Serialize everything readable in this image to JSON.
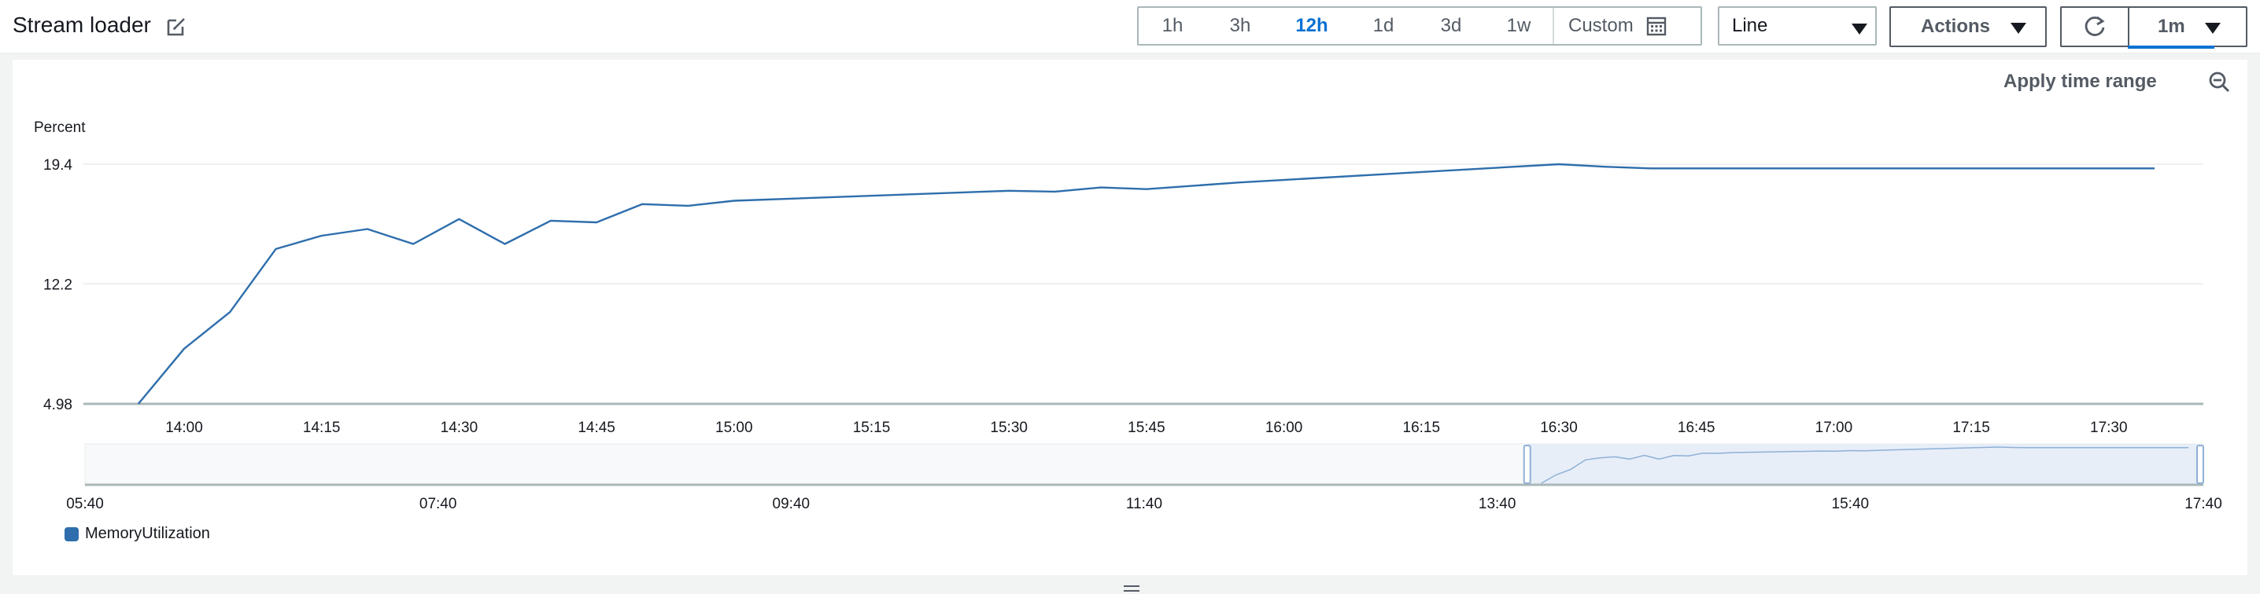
{
  "header": {
    "title": "Stream loader",
    "ranges": [
      "1h",
      "3h",
      "12h",
      "1d",
      "3d",
      "1w"
    ],
    "active_range": "12h",
    "custom_label": "Custom",
    "chart_type": "Line",
    "actions_label": "Actions",
    "interval": "1m"
  },
  "panel": {
    "apply_label": "Apply time range"
  },
  "colors": {
    "series": "#2e6eac",
    "accent": "#0972d3"
  },
  "chart_data": {
    "type": "line",
    "ylabel": "Percent",
    "ylim": [
      4.98,
      19.4
    ],
    "yticks": [
      "19.4",
      "12.2",
      "4.98"
    ],
    "x_ticks": [
      "14:00",
      "14:15",
      "14:30",
      "14:45",
      "15:00",
      "15:15",
      "15:30",
      "15:45",
      "16:00",
      "16:15",
      "16:30",
      "16:45",
      "17:00",
      "17:15",
      "17:30"
    ],
    "series": [
      {
        "name": "MemoryUtilization",
        "x": [
          "13:55",
          "14:00",
          "14:05",
          "14:10",
          "14:15",
          "14:20",
          "14:25",
          "14:30",
          "14:35",
          "14:40",
          "14:45",
          "14:50",
          "14:55",
          "15:00",
          "15:30",
          "15:35",
          "15:40",
          "15:45",
          "15:55",
          "16:30",
          "16:35",
          "16:40",
          "17:35"
        ],
        "values": [
          4.98,
          8.3,
          10.5,
          14.3,
          15.1,
          15.5,
          14.6,
          16.1,
          14.6,
          16.0,
          15.9,
          17.0,
          16.9,
          17.2,
          17.8,
          17.75,
          18.0,
          17.9,
          18.3,
          19.4,
          19.25,
          19.15,
          19.15
        ]
      }
    ],
    "navigator": {
      "x_ticks": [
        "05:40",
        "07:40",
        "09:40",
        "11:40",
        "13:40",
        "15:40",
        "17:40"
      ]
    },
    "legend": "bottom-left"
  }
}
